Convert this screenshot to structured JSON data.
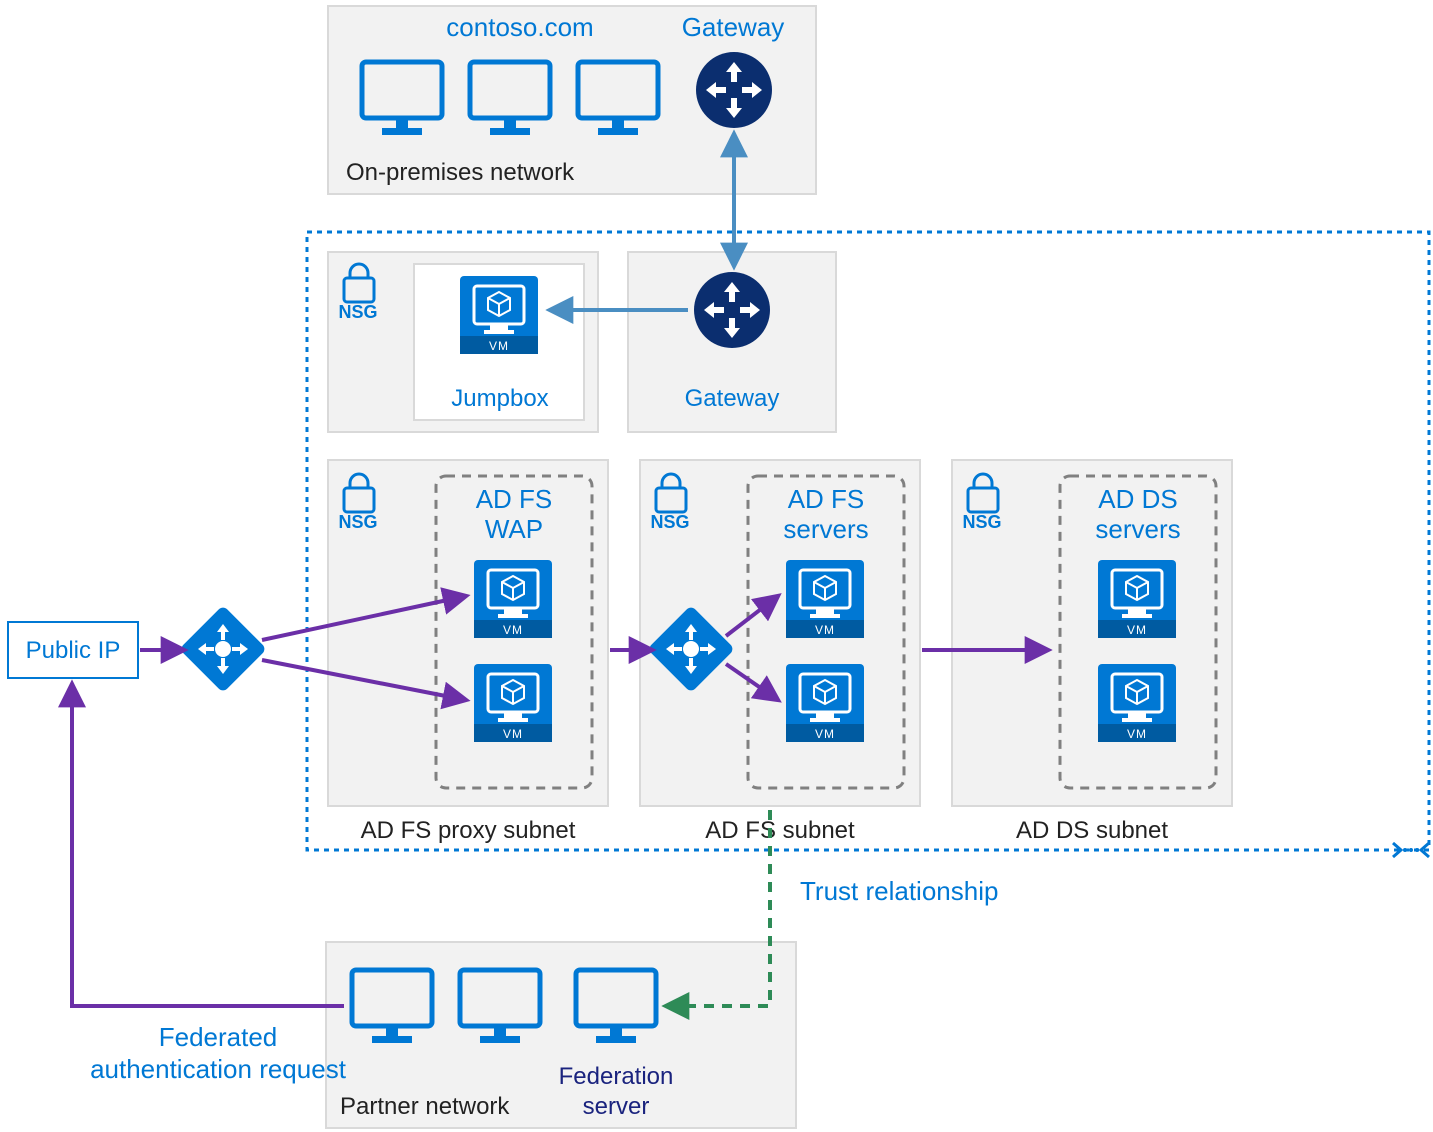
{
  "labels": {
    "onprem_domain": "contoso.com",
    "onprem_gateway": "Gateway",
    "onprem_name": "On-premises network",
    "jumpbox_nsg": "NSG",
    "jumpbox": "Jumpbox",
    "cloud_gateway": "Gateway",
    "public_ip": "Public IP",
    "adfs_proxy_title1": "AD FS",
    "adfs_proxy_title2": "WAP",
    "adfs_proxy_subnet": "AD FS proxy subnet",
    "adfs_title1": "AD FS",
    "adfs_title2": "servers",
    "adfs_subnet": "AD FS subnet",
    "adds_title1": "AD DS",
    "adds_title2": "servers",
    "adds_subnet": "AD DS subnet",
    "nsg": "NSG",
    "trust": "Trust relationship",
    "fed_auth1": "Federated",
    "fed_auth2": "authentication request",
    "partner_network": "Partner network",
    "federation_server1": "Federation",
    "federation_server2": "server",
    "vm": "VM"
  },
  "chart_data": {
    "type": "diagram",
    "title": "Azure AD FS hybrid identity architecture with on-premises and partner networks",
    "nodes": [
      {
        "id": "onprem",
        "label": "On-premises network",
        "contains": [
          "contoso.com (3 clients)",
          "Gateway"
        ]
      },
      {
        "id": "vnet",
        "label": "Azure virtual network (dotted boundary)",
        "contains": [
          "Jumpbox subnet (NSG)",
          "Gateway",
          "AD FS proxy subnet (NSG, AD FS WAP ×2, Load balancer)",
          "AD FS subnet (NSG, AD FS servers ×2, Load balancer)",
          "AD DS subnet (NSG, AD DS servers ×2)"
        ]
      },
      {
        "id": "public_ip",
        "label": "Public IP"
      },
      {
        "id": "partner",
        "label": "Partner network",
        "contains": [
          "2 clients",
          "Federation server"
        ]
      }
    ],
    "edges": [
      {
        "from": "On-premises Gateway",
        "to": "Azure Gateway",
        "style": "bidirectional",
        "color": "steelblue"
      },
      {
        "from": "Azure Gateway",
        "to": "Jumpbox",
        "style": "arrow",
        "color": "steelblue"
      },
      {
        "from": "Public IP",
        "to": "AD FS WAP load balancer",
        "style": "arrow",
        "color": "purple"
      },
      {
        "from": "AD FS WAP load balancer",
        "to": "AD FS WAP VMs",
        "style": "fan-out",
        "color": "purple"
      },
      {
        "from": "AD FS proxy subnet",
        "to": "AD FS load balancer",
        "style": "arrow",
        "color": "purple"
      },
      {
        "from": "AD FS load balancer",
        "to": "AD FS server VMs",
        "style": "fan-out",
        "color": "purple"
      },
      {
        "from": "AD FS subnet",
        "to": "AD DS subnet",
        "style": "arrow",
        "color": "purple"
      },
      {
        "from": "AD FS subnet",
        "to": "Partner Federation server",
        "style": "dashed",
        "color": "green",
        "label": "Trust relationship"
      },
      {
        "from": "Partner network",
        "to": "Public IP",
        "style": "arrow",
        "color": "purple",
        "label": "Federated authentication request"
      }
    ]
  }
}
